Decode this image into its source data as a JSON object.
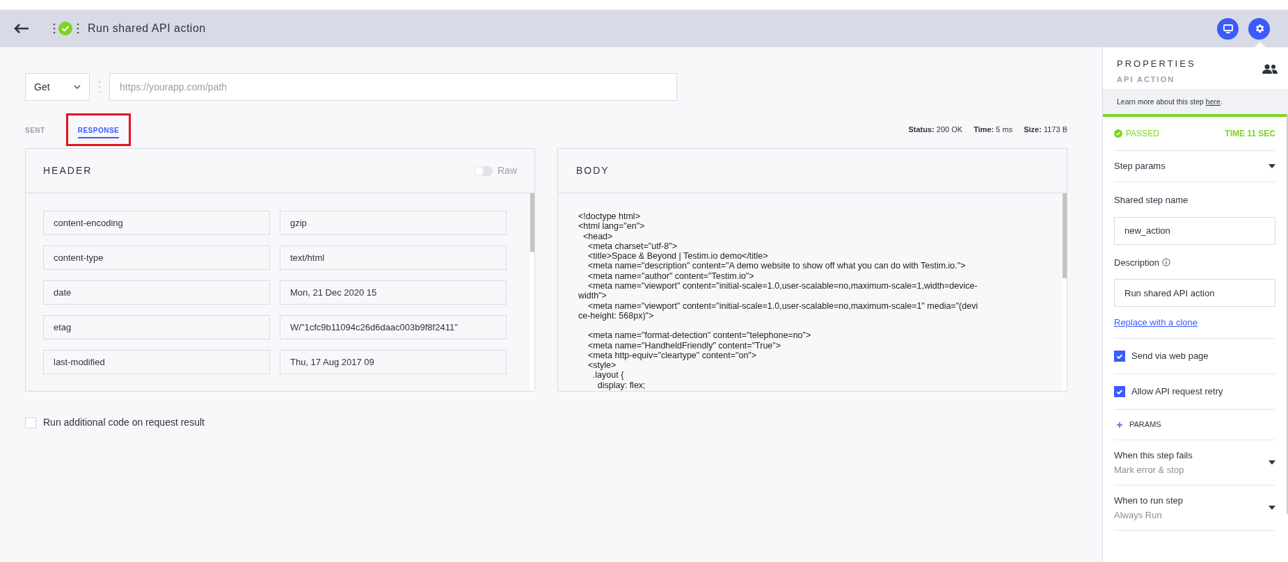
{
  "step_bar": {
    "title": "Run shared API action",
    "passed": true
  },
  "request": {
    "method": "Get",
    "url_placeholder": "https://yourapp.com/path"
  },
  "tabs": [
    {
      "label": "SENT",
      "selected": false
    },
    {
      "label": "RESPONSE",
      "selected": true
    }
  ],
  "status": [
    {
      "label": "Status:",
      "value": "200 OK"
    },
    {
      "label": "Time:",
      "value": "5 ms"
    },
    {
      "label": "Size:",
      "value": "1173 B"
    }
  ],
  "header_panel": {
    "title": "HEADER",
    "raw_label": "Raw",
    "raw_on": false,
    "rows": [
      {
        "key": "content-encoding",
        "value": "gzip"
      },
      {
        "key": "content-type",
        "value": "text/html"
      },
      {
        "key": "date",
        "value": "Mon, 21 Dec 2020 15"
      },
      {
        "key": "etag",
        "value": "W/\"1cfc9b11094c26d6daac003b9f8f2411\""
      },
      {
        "key": "last-modified",
        "value": "Thu, 17 Aug 2017 09"
      }
    ]
  },
  "body_panel": {
    "title": "BODY",
    "blocks": [
      [
        "<!doctype html>",
        "<html lang=\"en\">",
        "  <head>",
        "    <meta charset=\"utf-8\">",
        "    <title>Space & Beyond | Testim.io demo</title>",
        "    <meta name=\"description\" content=\"A demo website to show off what you can do with Testim.io.\">",
        "    <meta name=\"author\" content=\"Testim.io\">",
        "    <meta name=\"viewport\" content=\"initial-scale=1.0,user-scalable=no,maximum-scale=1,width=device-",
        "width\">",
        "    <meta name=\"viewport\" content=\"initial-scale=1.0,user-scalable=no,maximum-scale=1\" media=\"(devi",
        "ce-height: 568px)\">"
      ],
      [
        "    <meta name=\"format-detection\" content=\"telephone=no\">",
        "    <meta name=\"HandheldFriendly\" content=\"True\">",
        "    <meta http-equiv=\"cleartype\" content=\"on\">",
        "    <style>",
        "      .layout {",
        "        display: flex;"
      ]
    ]
  },
  "run_code": {
    "label": "Run additional code on request result",
    "checked": false
  },
  "properties": {
    "title": "PROPERTIES",
    "subtitle": "API ACTION",
    "learn_text": "Learn more about this step ",
    "learn_link": "here",
    "learn_end": ".",
    "result": "PASSED",
    "time": "TIME 11 SEC",
    "step_params": "Step params",
    "name_label": "Shared step name",
    "name_value": "new_action",
    "description_label": "Description",
    "description_value": "Run shared API action",
    "clone_link": "Replace with a clone",
    "options": [
      {
        "label": "Send via web page",
        "checked": true
      },
      {
        "label": "Allow API request retry",
        "checked": true
      }
    ],
    "params_label": "PARAMS",
    "dropdowns": [
      {
        "label": "When this step fails",
        "value": "Mark error & stop"
      },
      {
        "label": "When to run step",
        "value": "Always Run"
      }
    ]
  }
}
